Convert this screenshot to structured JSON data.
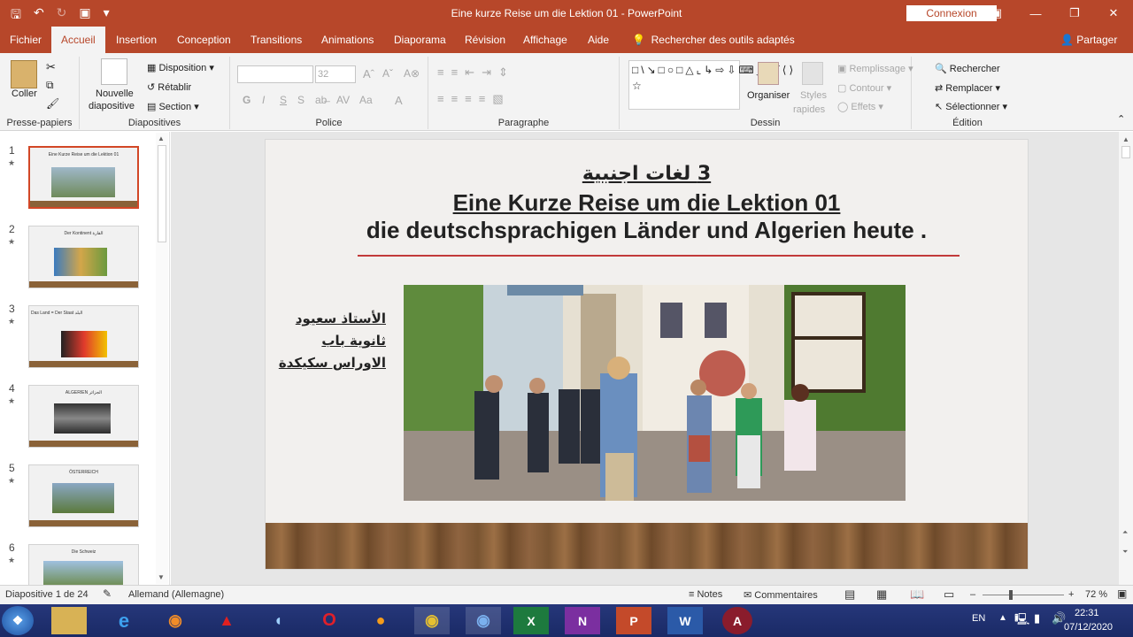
{
  "window": {
    "title": "Eine kurze Reise um die Lektion 01  -  PowerPoint",
    "signin": "Connexion"
  },
  "tabs": [
    "Fichier",
    "Accueil",
    "Insertion",
    "Conception",
    "Transitions",
    "Animations",
    "Diaporama",
    "Révision",
    "Affichage",
    "Aide"
  ],
  "tab_search": "Rechercher des outils adaptés",
  "share": "Partager",
  "ribbon": {
    "clipboard": {
      "paste": "Coller",
      "label": "Presse-papiers"
    },
    "slides": {
      "new_slide_1": "Nouvelle",
      "new_slide_2": "diapositive",
      "layout": "Disposition",
      "reset": "Rétablir",
      "section": "Section",
      "label": "Diapositives"
    },
    "font": {
      "size": "32",
      "bold": "G",
      "italic": "I",
      "underline": "S",
      "strike": "S",
      "label": "Police"
    },
    "paragraph": {
      "label": "Paragraphe"
    },
    "drawing": {
      "arrange": "Organiser",
      "styles_1": "Styles",
      "styles_2": "rapides",
      "fill": "Remplissage",
      "outline": "Contour",
      "effects": "Effets",
      "label": "Dessin"
    },
    "editing": {
      "find": "Rechercher",
      "replace": "Remplacer",
      "select": "Sélectionner",
      "label": "Édition"
    }
  },
  "thumbnails": [
    {
      "num": "1",
      "title": "Eine Kurze Reise um die Lektion 01"
    },
    {
      "num": "2",
      "title": "Der Kontinent  القارة"
    },
    {
      "num": "3",
      "title": "Das Land = Der Staat  البلد"
    },
    {
      "num": "4",
      "title": "ALGERIEN    الجزائر"
    },
    {
      "num": "5",
      "title": "ÖSTERREICH"
    },
    {
      "num": "6",
      "title": "Die Schweiz"
    }
  ],
  "slide": {
    "arabic_title": "3 لغات اجنبية",
    "line2": "Eine Kurze Reise um die Lektion 01",
    "line3": "die deutschsprachigen Länder und Algerien heute .",
    "teacher": [
      "الأستاذ سعيود",
      "ثانوية باب",
      "الاوراس سكيكدة"
    ]
  },
  "status": {
    "slide_count": "Diapositive 1 de 24",
    "language": "Allemand (Allemagne)",
    "notes": "Notes",
    "comments": "Commentaires",
    "zoom": "72 %"
  },
  "tray": {
    "lang": "EN",
    "time": "22:31",
    "date": "07/12/2020"
  },
  "colors": {
    "brand": "#b7472a",
    "taskbar": "#1a2a66",
    "rule": "#c23a3a"
  }
}
